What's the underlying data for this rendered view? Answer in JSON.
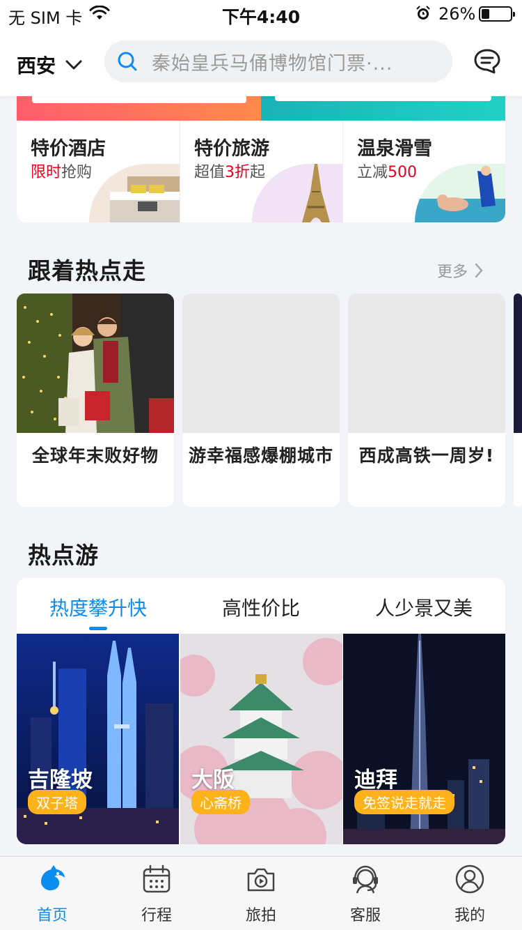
{
  "status_bar": {
    "carrier": "无 SIM 卡",
    "time": "下午4:40",
    "battery": "26%"
  },
  "header": {
    "city": "西安",
    "search_placeholder": "秦始皇兵马俑博物馆门票·..."
  },
  "quick_entries": [
    {
      "title": "特价酒店",
      "sub_red": "限时",
      "sub_rest": "抢购"
    },
    {
      "title": "特价旅游",
      "sub_pre": "超值",
      "sub_red": "3折",
      "sub_post": "起"
    },
    {
      "title": "温泉滑雪",
      "sub_pre": "立减",
      "sub_red": "500"
    }
  ],
  "hot_topics": {
    "title": "跟着热点走",
    "more": "更多",
    "items": [
      {
        "caption": "全球年末败好物"
      },
      {
        "caption": "游幸福感爆棚城市"
      },
      {
        "caption": "西成高铁一周岁!"
      }
    ]
  },
  "hot_tours": {
    "title": "热点游",
    "tabs": [
      "热度攀升快",
      "高性价比",
      "人少景又美"
    ],
    "active_tab": 0,
    "destinations": [
      {
        "name": "吉隆坡",
        "tag": "双子塔"
      },
      {
        "name": "大阪",
        "tag": "心斋桥"
      },
      {
        "name": "迪拜",
        "tag": "免签说走就走"
      }
    ]
  },
  "bottom_nav": [
    {
      "label": "首页",
      "icon": "home-dolphin-icon",
      "active": true
    },
    {
      "label": "行程",
      "icon": "calendar-icon",
      "active": false
    },
    {
      "label": "旅拍",
      "icon": "camera-icon",
      "active": false
    },
    {
      "label": "客服",
      "icon": "headset-icon",
      "active": false
    },
    {
      "label": "我的",
      "icon": "user-icon",
      "active": false
    }
  ],
  "colors": {
    "accent": "#0a8cf0",
    "price_red": "#e8001c",
    "tag_yellow": "#ffb21a"
  }
}
